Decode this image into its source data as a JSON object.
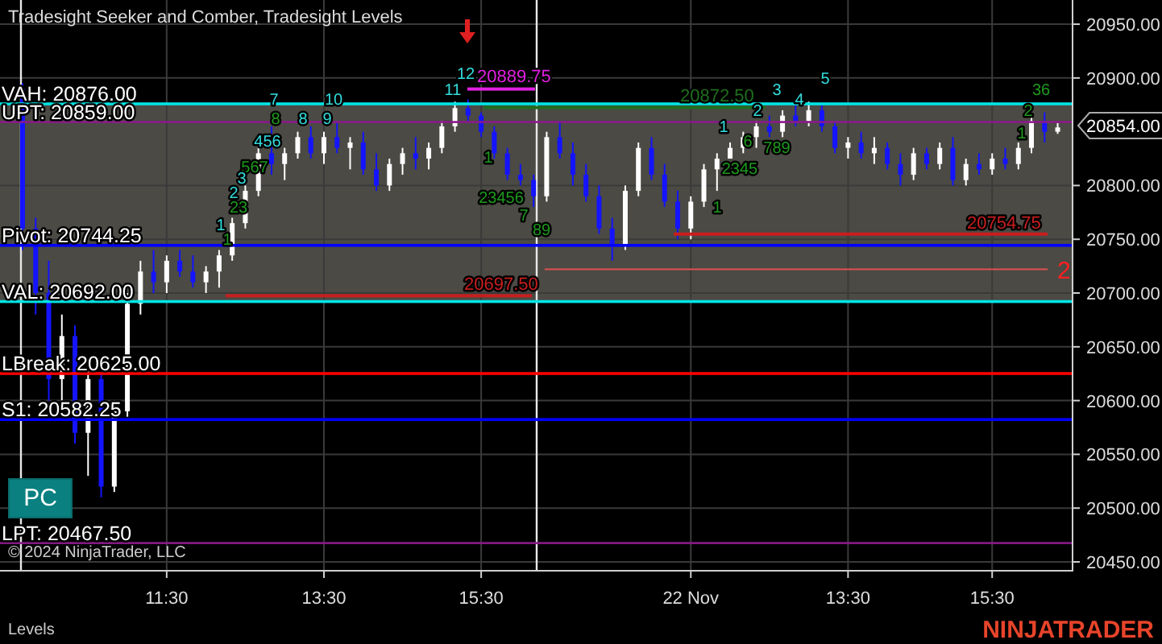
{
  "chart": {
    "title": "Tradesight Seeker and Comber, Tradesight Levels",
    "chart_data": {
      "type": "candlestick",
      "categories": [
        null,
        null,
        null,
        null,
        null,
        null,
        null,
        null,
        null,
        null,
        null,
        "11:30",
        null,
        null,
        null,
        null,
        null,
        null,
        null,
        null,
        null,
        null,
        null,
        "13:30",
        null,
        null,
        null,
        null,
        null,
        null,
        null,
        null,
        null,
        null,
        null,
        "15:30",
        null,
        null,
        null,
        null,
        null,
        null,
        null,
        null,
        null,
        null,
        null,
        null,
        null,
        null,
        null,
        "22 Nov",
        null,
        null,
        null,
        null,
        null,
        null,
        null,
        null,
        null,
        null,
        null,
        "13:30",
        null,
        null,
        null,
        null,
        null,
        null,
        null,
        null,
        null,
        null,
        "15:30",
        null,
        null,
        null,
        null,
        null
      ],
      "ohlc": [
        [
          20890,
          20895,
          20740,
          20760
        ],
        [
          20760,
          20770,
          20680,
          20700
        ],
        [
          20700,
          20730,
          20600,
          20620
        ],
        [
          20620,
          20680,
          20590,
          20660
        ],
        [
          20660,
          20670,
          20560,
          20570
        ],
        [
          20570,
          20640,
          20530,
          20620
        ],
        [
          20620,
          20625,
          20510,
          20520
        ],
        [
          20520,
          20600,
          20515,
          20590
        ],
        [
          20590,
          20700,
          20585,
          20690
        ],
        [
          20690,
          20730,
          20680,
          20720
        ],
        [
          20720,
          20740,
          20700,
          20710
        ],
        [
          20710,
          20735,
          20700,
          20730
        ],
        [
          20730,
          20740,
          20715,
          20720
        ],
        [
          20720,
          20735,
          20705,
          20710
        ],
        [
          20710,
          20725,
          20700,
          20720
        ],
        [
          20720,
          20740,
          20705,
          20735
        ],
        [
          20735,
          20770,
          20730,
          20765
        ],
        [
          20765,
          20800,
          20760,
          20795
        ],
        [
          20795,
          20835,
          20790,
          20830
        ],
        [
          20830,
          20855,
          20810,
          20820
        ],
        [
          20820,
          20835,
          20805,
          20830
        ],
        [
          20830,
          20850,
          20825,
          20845
        ],
        [
          20845,
          20855,
          20825,
          20830
        ],
        [
          20830,
          20850,
          20820,
          20845
        ],
        [
          20845,
          20860,
          20830,
          20835
        ],
        [
          20835,
          20845,
          20815,
          20840
        ],
        [
          20840,
          20850,
          20810,
          20815
        ],
        [
          20815,
          20830,
          20795,
          20800
        ],
        [
          20800,
          20825,
          20795,
          20820
        ],
        [
          20820,
          20835,
          20810,
          20830
        ],
        [
          20830,
          20845,
          20815,
          20825
        ],
        [
          20825,
          20840,
          20815,
          20835
        ],
        [
          20835,
          20860,
          20830,
          20855
        ],
        [
          20855,
          20878,
          20850,
          20872
        ],
        [
          20872,
          20880,
          20860,
          20865
        ],
        [
          20865,
          20868,
          20845,
          20850
        ],
        [
          20850,
          20855,
          20825,
          20830
        ],
        [
          20830,
          20835,
          20805,
          20810
        ],
        [
          20810,
          20820,
          20800,
          20805
        ],
        [
          20805,
          20810,
          20780,
          20790
        ],
        [
          20790,
          20850,
          20785,
          20845
        ],
        [
          20845,
          20860,
          20825,
          20830
        ],
        [
          20830,
          20840,
          20800,
          20810
        ],
        [
          20810,
          20820,
          20785,
          20790
        ],
        [
          20790,
          20800,
          20755,
          20760
        ],
        [
          20760,
          20770,
          20730,
          20745
        ],
        [
          20745,
          20800,
          20740,
          20795
        ],
        [
          20795,
          20840,
          20790,
          20835
        ],
        [
          20835,
          20845,
          20805,
          20810
        ],
        [
          20810,
          20820,
          20780,
          20785
        ],
        [
          20785,
          20795,
          20750,
          20760
        ],
        [
          20760,
          20790,
          20750,
          20785
        ],
        [
          20785,
          20820,
          20780,
          20815
        ],
        [
          20815,
          20830,
          20795,
          20825
        ],
        [
          20825,
          20840,
          20825,
          20835
        ],
        [
          20835,
          20850,
          20830,
          20845
        ],
        [
          20845,
          20860,
          20835,
          20855
        ],
        [
          20855,
          20865,
          20845,
          20850
        ],
        [
          20850,
          20870,
          20845,
          20865
        ],
        [
          20865,
          20875,
          20855,
          20860
        ],
        [
          20860,
          20878,
          20855,
          20870
        ],
        [
          20870,
          20875,
          20850,
          20855
        ],
        [
          20855,
          20860,
          20830,
          20835
        ],
        [
          20835,
          20845,
          20825,
          20840
        ],
        [
          20840,
          20850,
          20825,
          20830
        ],
        [
          20830,
          20845,
          20820,
          20835
        ],
        [
          20835,
          20840,
          20815,
          20820
        ],
        [
          20820,
          20830,
          20800,
          20810
        ],
        [
          20810,
          20835,
          20805,
          20830
        ],
        [
          20830,
          20835,
          20815,
          20820
        ],
        [
          20820,
          20840,
          20815,
          20835
        ],
        [
          20835,
          20845,
          20800,
          20805
        ],
        [
          20805,
          20825,
          20800,
          20820
        ],
        [
          20820,
          20830,
          20810,
          20815
        ],
        [
          20815,
          20830,
          20810,
          20825
        ],
        [
          20825,
          20835,
          20815,
          20820
        ],
        [
          20820,
          20840,
          20815,
          20835
        ],
        [
          20835,
          20865,
          20830,
          20860
        ],
        [
          20860,
          20868,
          20840,
          20850
        ],
        [
          20850,
          20858,
          20848,
          20854
        ]
      ],
      "ylim": [
        20442.5,
        20972.5
      ],
      "grid": true,
      "yticks": [
        {
          "value": 20950,
          "label": "20950.00"
        },
        {
          "value": 20900,
          "label": "20900.00"
        },
        {
          "value": 20800,
          "label": "20800.00"
        },
        {
          "value": 20750,
          "label": "20750.00"
        },
        {
          "value": 20700,
          "label": "20700.00"
        },
        {
          "value": 20650,
          "label": "20650.00"
        },
        {
          "value": 20600,
          "label": "20600.00"
        },
        {
          "value": 20550,
          "label": "20550.00"
        },
        {
          "value": 20500,
          "label": "20500.00"
        },
        {
          "value": 20450,
          "label": "20450.00"
        }
      ]
    },
    "price_axis": {
      "current_price": "20854.00"
    },
    "levels": [
      {
        "label": "VAH: 20876.00",
        "color": "#00e5e5"
      },
      {
        "label": "UPT: 20859.00",
        "color": "#8a1a8a"
      },
      {
        "label": "Pivot: 20744.25",
        "color": "#0000ff"
      },
      {
        "label": "VAL: 20692.00",
        "color": "#00e5e5"
      },
      {
        "label": "LBreak: 20625.00",
        "color": "#ff0000"
      },
      {
        "label": "S1: 20582.25",
        "color": "#0000ff"
      },
      {
        "label": "LPT: 20467.50",
        "color": "#8a1a8a"
      }
    ],
    "price_tags": [
      {
        "text": "20889.75",
        "color": "#e020e0"
      },
      {
        "text": "20872.50",
        "color": "#1f6e1f"
      },
      {
        "text": "20754.75",
        "color": "#c81e1e"
      },
      {
        "text": "20697.50",
        "color": "#c81e1e"
      }
    ],
    "signal": "2",
    "markers": [
      {
        "text": "12",
        "kind": "seeker"
      },
      {
        "text": "5",
        "kind": "seeker"
      },
      {
        "text": "11",
        "kind": "seeker"
      },
      {
        "text": "3",
        "kind": "seeker"
      },
      {
        "text": "36",
        "kind": "comber"
      },
      {
        "text": "7",
        "kind": "seeker"
      },
      {
        "text": "10",
        "kind": "seeker"
      },
      {
        "text": "4",
        "kind": "seeker"
      },
      {
        "text": "2",
        "kind": "seeker"
      },
      {
        "text": "2",
        "kind": "comber"
      },
      {
        "text": "8",
        "kind": "comber"
      },
      {
        "text": "8",
        "kind": "seeker"
      },
      {
        "text": "9",
        "kind": "seeker"
      },
      {
        "text": "1",
        "kind": "seeker"
      },
      {
        "text": "1",
        "kind": "comber"
      },
      {
        "text": "456",
        "kind": "seeker"
      },
      {
        "text": "6",
        "kind": "comber"
      },
      {
        "text": "789",
        "kind": "comber"
      },
      {
        "text": "1",
        "kind": "comber"
      },
      {
        "text": "567",
        "kind": "comber"
      },
      {
        "text": "2345",
        "kind": "comber"
      },
      {
        "text": "3",
        "kind": "seeker"
      },
      {
        "text": "2",
        "kind": "seeker"
      },
      {
        "text": "23456",
        "kind": "comber"
      },
      {
        "text": "23",
        "kind": "comber"
      },
      {
        "text": "1",
        "kind": "comber"
      },
      {
        "text": "7",
        "kind": "comber"
      },
      {
        "text": "1",
        "kind": "seeker"
      },
      {
        "text": "89",
        "kind": "comber"
      },
      {
        "text": "1",
        "kind": "comber"
      }
    ],
    "copyright": "© 2024 NinjaTrader, LLC",
    "pc_button": "PC",
    "panel_label": "Levels",
    "logo": "NINJATRADER"
  }
}
